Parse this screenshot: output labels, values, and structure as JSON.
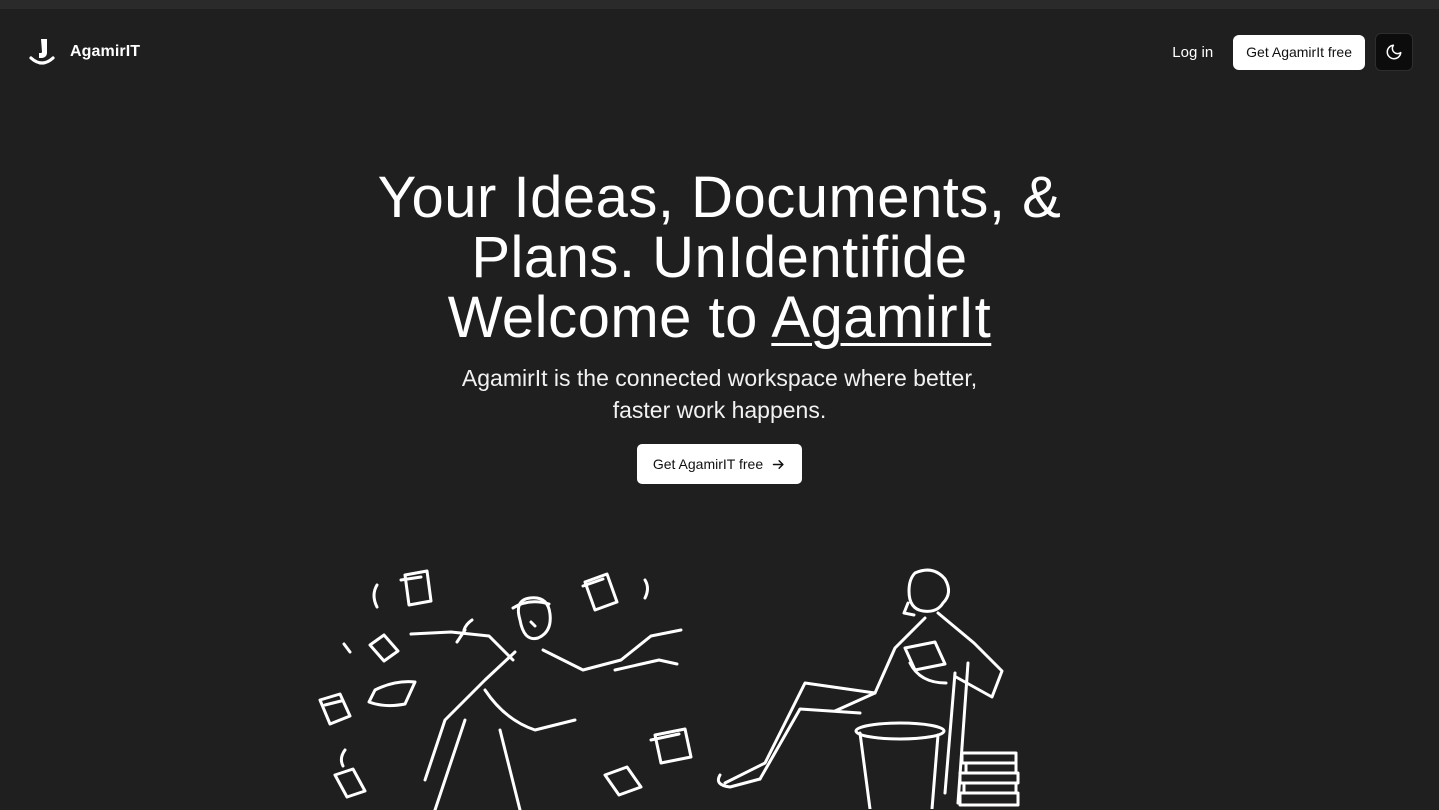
{
  "app": {
    "name": "AgamirIT"
  },
  "nav": {
    "login_label": "Log in",
    "cta_label": "Get AgamirIt free",
    "theme_icon": "moon-icon"
  },
  "hero": {
    "headline_line1": "Your Ideas, Documents, &",
    "headline_line2": "Plans. UnIdentifide",
    "headline_line3_prefix": "Welcome to ",
    "headline_brand": "AgamirIt",
    "subtitle": "AgamirIt is the connected workspace where better, faster work happens.",
    "cta_label": "Get AgamirIT free",
    "cta_icon": "arrow-right-icon"
  },
  "illustrations": {
    "left": "juggling-papers-man-illustration",
    "right": "reading-woman-illustration"
  },
  "colors": {
    "background": "#1f1f1f",
    "text": "#ffffff",
    "button_bg": "#ffffff",
    "button_text": "#111111",
    "toggle_bg": "#0c0c0c"
  }
}
